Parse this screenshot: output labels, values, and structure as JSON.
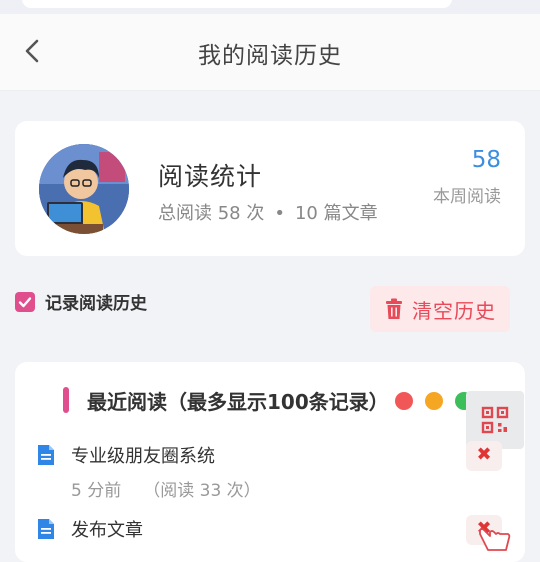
{
  "navbar": {
    "title": "我的阅读历史",
    "back_icon": "chevron-left-icon"
  },
  "stats": {
    "title": "阅读统计",
    "total_reads": "总阅读 58 次",
    "separator": "•",
    "article_count": "10 篇文章",
    "week_number": "58",
    "week_label": "本周阅读"
  },
  "settings": {
    "record_history_label": "记录阅读历史",
    "record_history_checked": true,
    "clear_button_label": "清空历史"
  },
  "recent": {
    "title": "最近阅读（最多显示100条记录）",
    "items": [
      {
        "title": "专业级朋友圈系统",
        "time": "5 分前",
        "reads": "（阅读 33 次）"
      },
      {
        "title": "发布文章",
        "time": "",
        "reads": ""
      }
    ]
  },
  "overlay": {
    "dot_colors": [
      "#f25757",
      "#f5a623",
      "#3cbf5a"
    ],
    "tool_icon": "qr-code-icon",
    "delete_glyph": "✖"
  },
  "colors": {
    "accent": "#e04e8e",
    "link_blue": "#3d8ee0",
    "danger": "#e84a5a"
  }
}
